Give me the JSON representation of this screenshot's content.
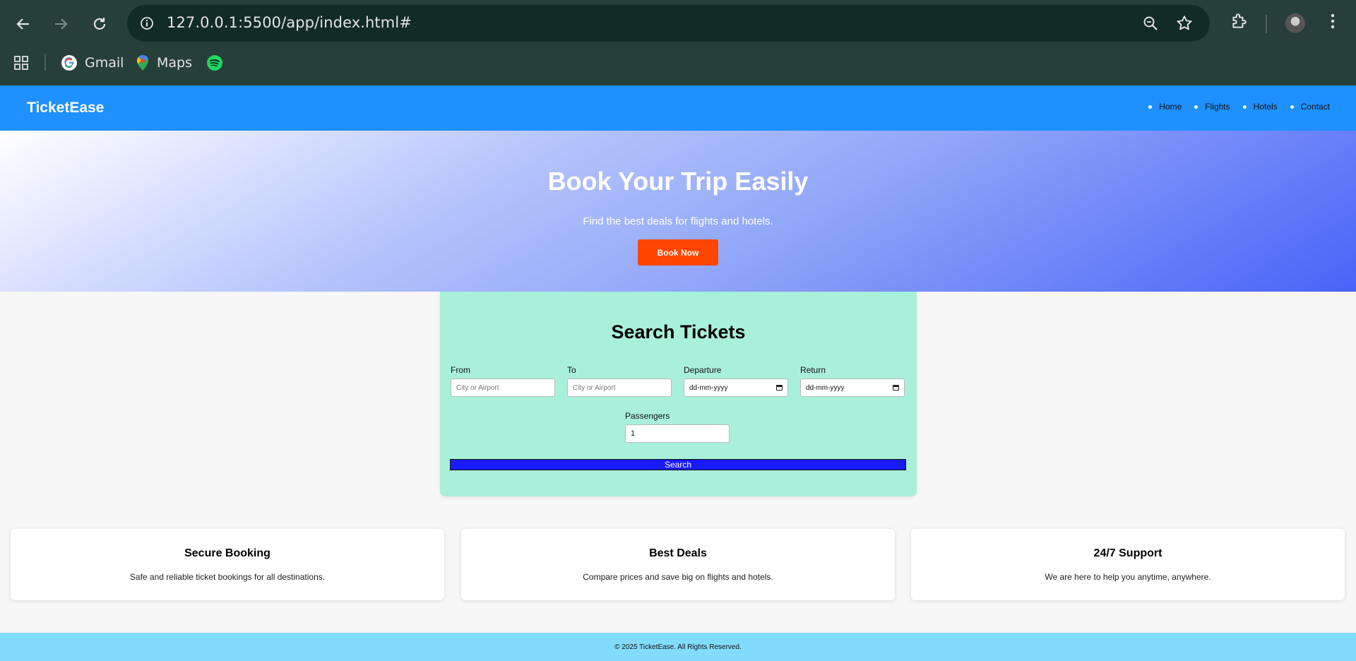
{
  "browser": {
    "url": "127.0.0.1:5500/app/index.html#",
    "bookmarks": [
      {
        "label": "Gmail",
        "icon": "google-icon"
      },
      {
        "label": "Maps",
        "icon": "maps-pin-icon"
      },
      {
        "label": "",
        "icon": "spotify-icon"
      }
    ]
  },
  "site": {
    "brand": "TicketEase",
    "nav": [
      "Home",
      "Flights",
      "Hotels",
      "Contact"
    ],
    "colors": {
      "header": "#1e90ff",
      "cta": "#ff4500",
      "search_bg": "#a9f0da",
      "search_btn": "#1a1aff",
      "footer": "#82dcfd"
    }
  },
  "hero": {
    "title": "Book Your Trip Easily",
    "subtitle": "Find the best deals for flights and hotels.",
    "cta": "Book Now"
  },
  "search": {
    "title": "Search Tickets",
    "from": {
      "label": "From",
      "placeholder": "City or Airport"
    },
    "to": {
      "label": "To",
      "placeholder": "City or Airport"
    },
    "departure": {
      "label": "Departure",
      "value": "dd-mm-yyyy"
    },
    "return": {
      "label": "Return",
      "value": "dd-mm-yyyy"
    },
    "passengers": {
      "label": "Passengers",
      "value": "1"
    },
    "button": "Search"
  },
  "features": [
    {
      "title": "Secure Booking",
      "text": "Safe and reliable ticket bookings for all destinations."
    },
    {
      "title": "Best Deals",
      "text": "Compare prices and save big on flights and hotels."
    },
    {
      "title": "24/7 Support",
      "text": "We are here to help you anytime, anywhere."
    }
  ],
  "footer": "© 2025 TicketEase. All Rights Reserved."
}
